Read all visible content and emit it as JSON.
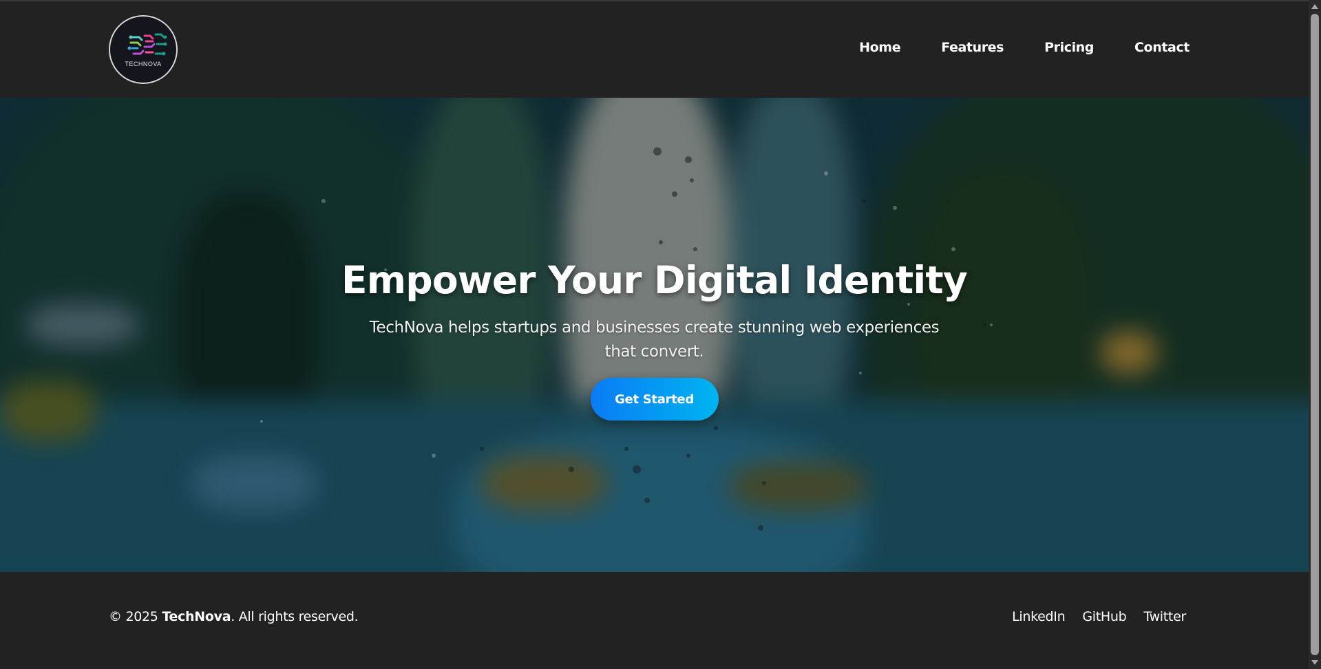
{
  "header": {
    "logo_text": "TECHNOVA",
    "nav": [
      {
        "label": "Home"
      },
      {
        "label": "Features"
      },
      {
        "label": "Pricing"
      },
      {
        "label": "Contact"
      }
    ]
  },
  "hero": {
    "title": "Empower Your Digital Identity",
    "subtitle": "TechNova helps startups and businesses create stunning web experiences that convert.",
    "cta_label": "Get Started"
  },
  "footer": {
    "copyright_prefix": "© 2025 ",
    "brand": "TechNova",
    "copyright_suffix": ". All rights reserved.",
    "social": [
      {
        "label": "LinkedIn"
      },
      {
        "label": "GitHub"
      },
      {
        "label": "Twitter"
      }
    ]
  },
  "colors": {
    "background": "#222222",
    "cta_start": "#0a7cf5",
    "cta_end": "#00b4f0"
  },
  "icons": {
    "logo": "circuit-brain-logo-icon"
  }
}
